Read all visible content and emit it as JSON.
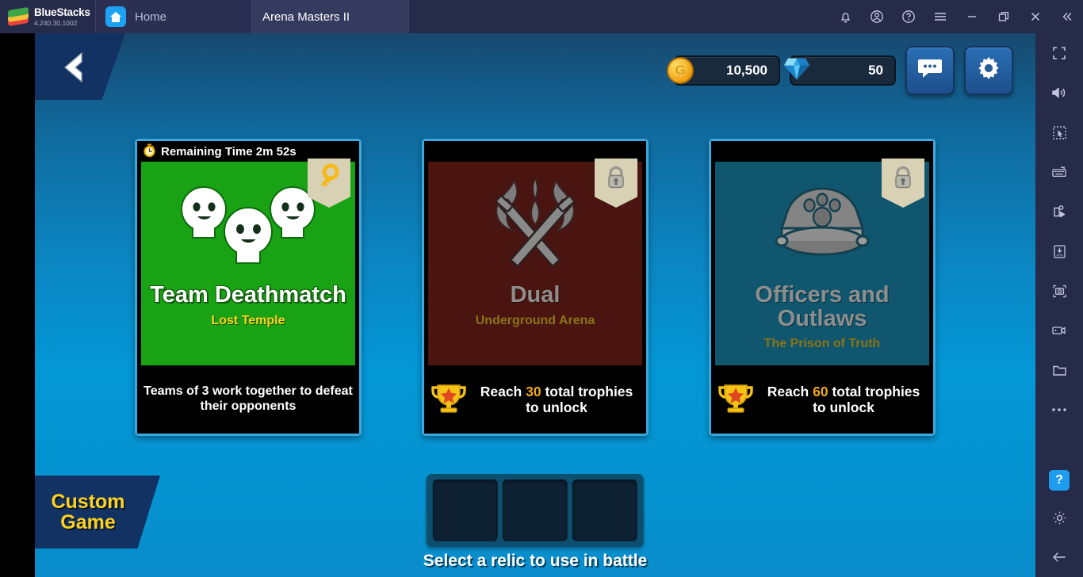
{
  "titlebar": {
    "brand_name": "BlueStacks",
    "brand_version": "4.240.30.1002",
    "tabs": [
      {
        "label": "Home",
        "icon": "home-icon",
        "active": false
      },
      {
        "label": "Arena Masters II",
        "icon": "game-avatar-icon",
        "active": true
      }
    ],
    "window_controls": [
      {
        "name": "notifications-icon",
        "glyph": "bell"
      },
      {
        "name": "account-icon",
        "glyph": "account"
      },
      {
        "name": "help-icon",
        "glyph": "question"
      },
      {
        "name": "menu-icon",
        "glyph": "hamburger"
      },
      {
        "name": "minimize-icon",
        "glyph": "minimize"
      },
      {
        "name": "restore-icon",
        "glyph": "restore"
      },
      {
        "name": "close-icon",
        "glyph": "close"
      },
      {
        "name": "collapse-icon",
        "glyph": "double-chevron-left"
      }
    ]
  },
  "sidebar": {
    "items": [
      {
        "name": "fullscreen-icon"
      },
      {
        "name": "volume-icon"
      },
      {
        "name": "cursor-select-icon"
      },
      {
        "name": "keyboard-controls-icon"
      },
      {
        "name": "macro-recorder-icon"
      },
      {
        "name": "install-apk-icon"
      },
      {
        "name": "screenshot-icon"
      },
      {
        "name": "screen-record-icon"
      },
      {
        "name": "media-folder-icon"
      },
      {
        "name": "more-options-icon"
      }
    ],
    "bottom_items": [
      {
        "name": "help-button",
        "label": "?"
      },
      {
        "name": "settings-gear-icon"
      },
      {
        "name": "back-arrow-icon"
      }
    ]
  },
  "game": {
    "back_button": "back-chevron-icon",
    "currency": [
      {
        "name": "gold",
        "icon": "gold-coin-icon",
        "value": "10,500"
      },
      {
        "name": "gems",
        "icon": "gem-icon",
        "value": "50"
      }
    ],
    "top_buttons": [
      {
        "name": "chat-button",
        "icon": "chat-bubble-icon"
      },
      {
        "name": "settings-button",
        "icon": "gear-icon"
      }
    ],
    "cards": [
      {
        "header": "Remaining Time 2m 52s",
        "header_icon": "stopwatch-icon",
        "title": "Team Deathmatch",
        "subtitle": "Lost Temple",
        "art": "three-skulls-icon",
        "art_theme": "green",
        "badge": "key-icon",
        "locked": false,
        "footer_text": "Teams of 3 work together to defeat their opponents",
        "footer_icon": null,
        "footer_num": null
      },
      {
        "header": "",
        "header_icon": null,
        "title": "Dual",
        "subtitle": "Underground Arena",
        "art": "crossed-swords-flame-icon",
        "art_theme": "red",
        "badge": "lock-icon",
        "locked": true,
        "footer_text_pre": "Reach ",
        "footer_num": "30",
        "footer_text_post": " total trophies to unlock",
        "footer_icon": "trophy-icon"
      },
      {
        "header": "",
        "header_icon": null,
        "title": "Officers and Outlaws",
        "subtitle": "The Prison of Truth",
        "art": "police-cap-icon",
        "art_theme": "teal",
        "badge": "lock-icon",
        "locked": true,
        "footer_text_pre": "Reach ",
        "footer_num": "60",
        "footer_text_post": " total trophies to unlock",
        "footer_icon": "trophy-icon"
      }
    ],
    "custom_game": {
      "line1": "Custom",
      "line2": "Game"
    },
    "relics": {
      "slots": 3,
      "label": "Select a relic to use in battle"
    }
  },
  "colors": {
    "titlebar_bg": "#262b4a",
    "tab_active_bg": "#353b5e",
    "accent_blue": "#1e9df0",
    "card_border": "#3aa9e0",
    "gold": "#ffd21e",
    "green_art": "#19a214",
    "red_art": "#4a1410",
    "teal_art": "#10566e"
  }
}
